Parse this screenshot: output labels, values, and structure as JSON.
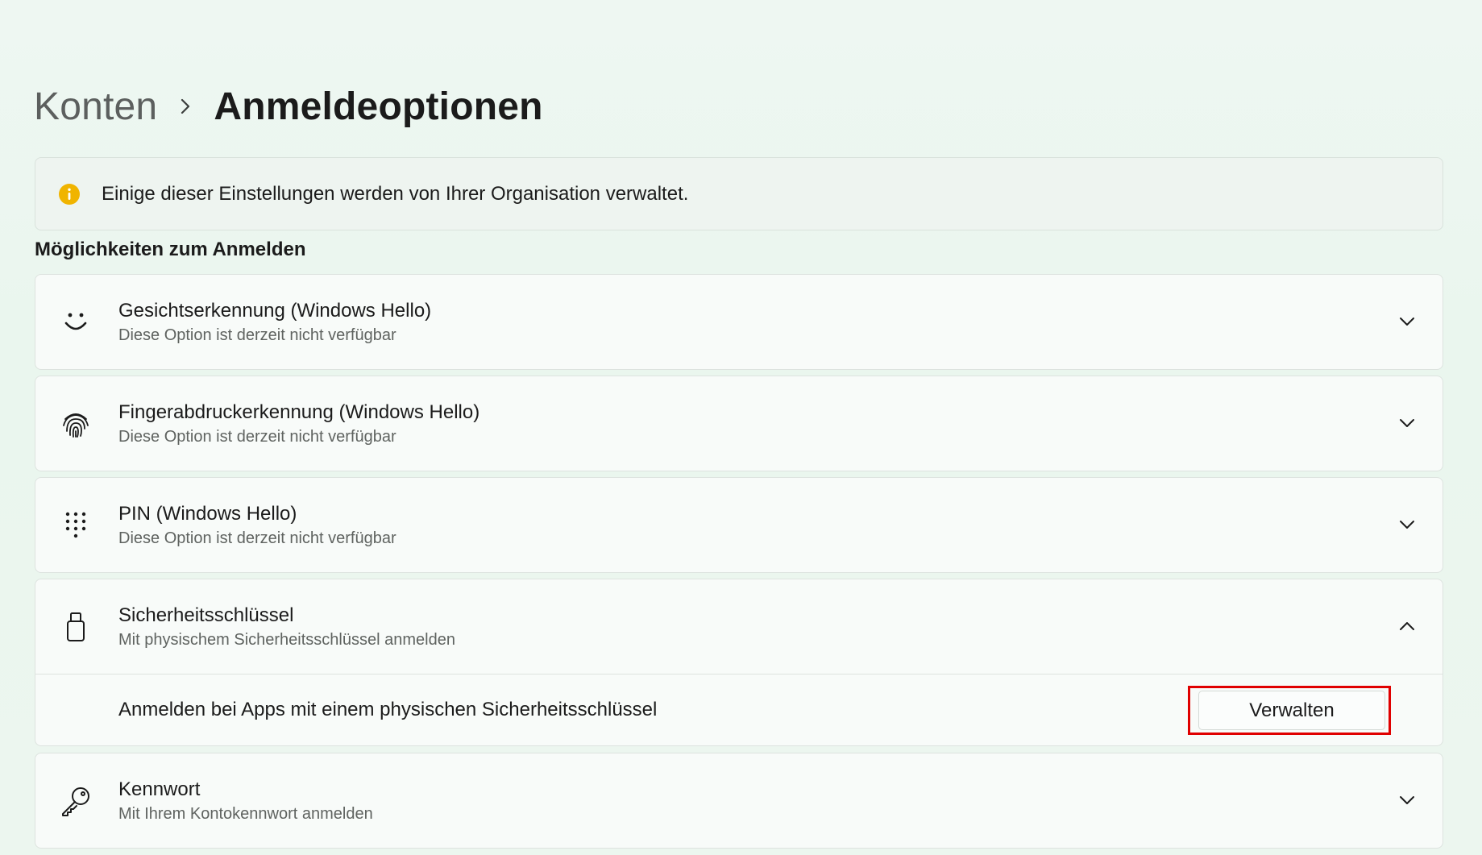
{
  "breadcrumb": {
    "parent": "Konten",
    "current": "Anmeldeoptionen"
  },
  "info_bar": {
    "text": "Einige dieser Einstellungen werden von Ihrer Organisation verwaltet.",
    "icon": "info-icon",
    "icon_color": "#f0b400"
  },
  "section_title": "Möglichkeiten zum Anmelden",
  "options": [
    {
      "title": "Gesichtserkennung (Windows Hello)",
      "subtitle": "Diese Option ist derzeit nicht verfügbar",
      "icon": "face-icon",
      "expanded": false
    },
    {
      "title": "Fingerabdruckerkennung (Windows Hello)",
      "subtitle": "Diese Option ist derzeit nicht verfügbar",
      "icon": "fingerprint-icon",
      "expanded": false
    },
    {
      "title": "PIN (Windows Hello)",
      "subtitle": "Diese Option ist derzeit nicht verfügbar",
      "icon": "pin-keypad-icon",
      "expanded": false
    },
    {
      "title": "Sicherheitsschlüssel",
      "subtitle": "Mit physischem Sicherheitsschlüssel anmelden",
      "icon": "usb-key-icon",
      "expanded": true,
      "detail": {
        "text": "Anmelden bei Apps mit einem physischen Sicherheitsschlüssel",
        "button_label": "Verwalten"
      }
    },
    {
      "title": "Kennwort",
      "subtitle": "Mit Ihrem Kontokennwort anmelden",
      "icon": "key-icon",
      "expanded": false
    }
  ],
  "colors": {
    "highlight_border": "#e00000",
    "accent_info": "#f0b400"
  }
}
